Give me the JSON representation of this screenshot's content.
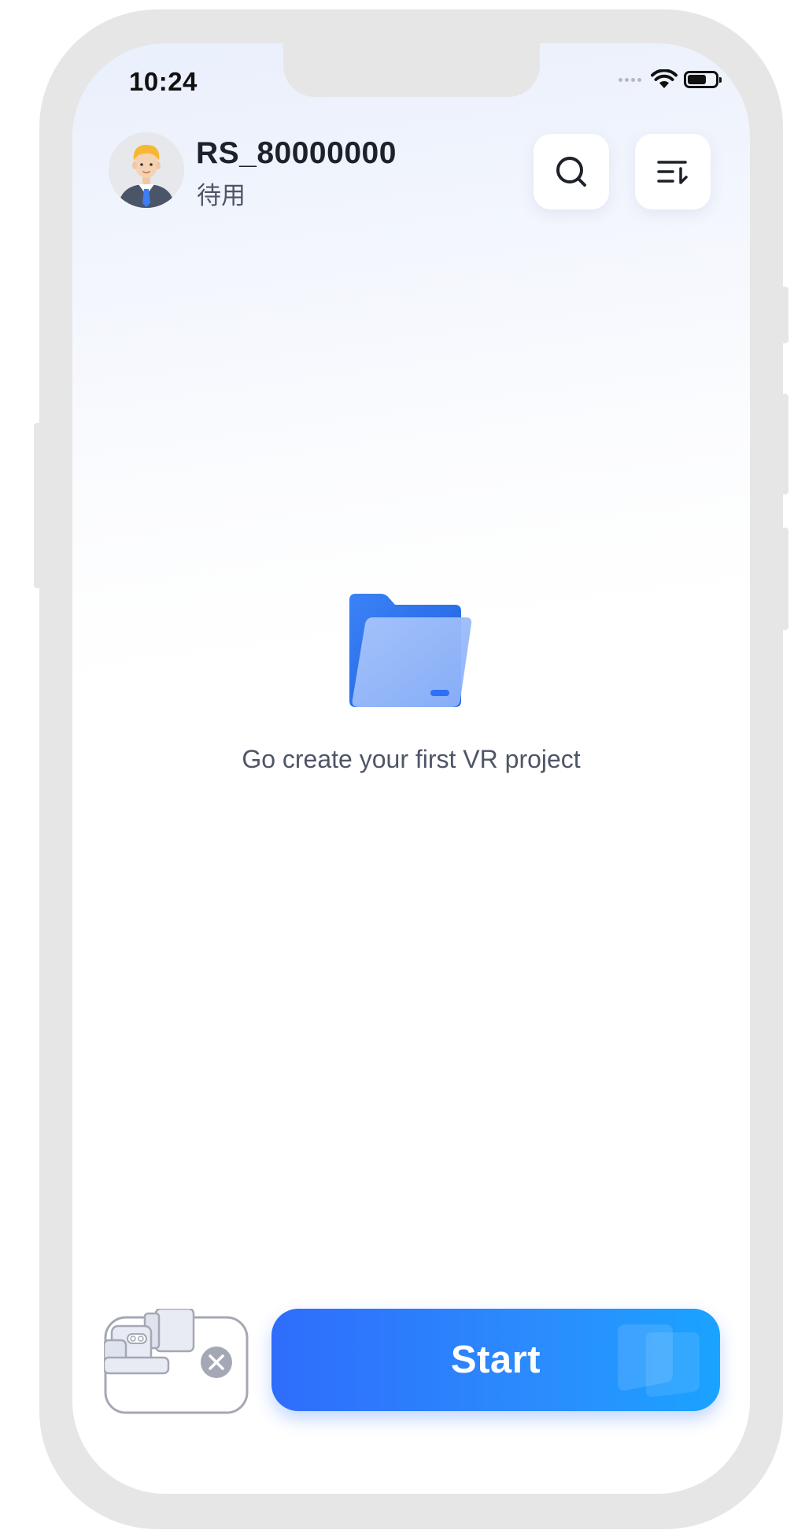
{
  "status_bar": {
    "time": "10:24",
    "icons": [
      "signal-dots-icon",
      "wifi-icon",
      "battery-icon"
    ]
  },
  "header": {
    "avatar_icon": "user-avatar-icon",
    "username": "RS_80000000",
    "status": "待用",
    "search_icon": "search-icon",
    "sort_icon": "sort-icon"
  },
  "empty_state": {
    "icon": "folder-icon",
    "message": "Go create your first VR project"
  },
  "footer": {
    "device_icon": "camera-device-icon",
    "disconnected_icon": "close-circle-icon",
    "start_label": "Start"
  },
  "colors": {
    "accent_start": "#2e6dfb",
    "accent_end": "#1aa3ff",
    "text_primary": "#1d2129",
    "text_secondary": "#4e5566"
  }
}
